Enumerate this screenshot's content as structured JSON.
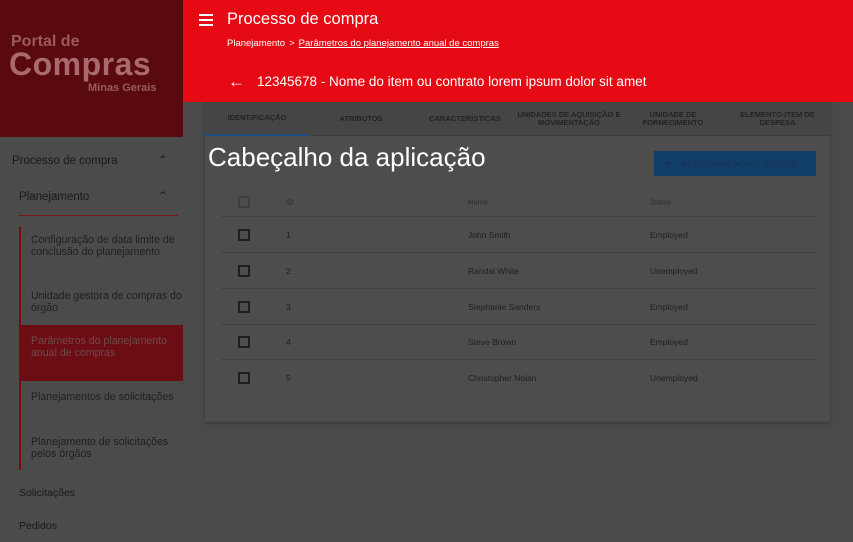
{
  "brand": {
    "line1": "Portal de",
    "line2": "Compras",
    "line3": "Minas Gerais"
  },
  "sidebar": {
    "processo": "Processo de compra",
    "planejamento": "Planejamento",
    "items": [
      {
        "label": "Configuração de data limite de conclusão do planejamento"
      },
      {
        "label": "Unidade gestora de compras do órgão"
      },
      {
        "label": "Parâmetros do planejamento anual de compras"
      },
      {
        "label": "Planejamentos de solicitações"
      },
      {
        "label": "Planejamento de solicitações pelos órgãos"
      }
    ],
    "solicitacoes": "Solicitações",
    "pedidos": "Pedidos"
  },
  "header": {
    "title": "Processo de compra",
    "breadcrumb_root": "Planejamento",
    "breadcrumb_sep": ">",
    "breadcrumb_current": "Parâmetros do planejamento anual de compras",
    "item_title": "12345678 - Nome do item ou contrato lorem ipsum dolor sit amet",
    "back_icon": "arrow-left-icon",
    "menu_icon": "hamburger-menu-icon"
  },
  "tabs": [
    {
      "label": "IDENTIFICAÇÃO",
      "active": true
    },
    {
      "label": "ATRIBUTOS"
    },
    {
      "label": "CARACTERÍSTICAS"
    },
    {
      "label": "UNIDADES DE AQUISIÇÃO E MOVIMENTAÇÃO"
    },
    {
      "label": "UNIDADE DE FORNECIMENTO"
    },
    {
      "label": "ELEMENTO-ITEM DE DESPESA"
    }
  ],
  "overlay_label": "Cabeçalho da aplicação",
  "add_button": {
    "label": "ADICIONAR NOVO OBJETO",
    "icon": "plus-icon"
  },
  "table": {
    "headers": {
      "id": "ID",
      "name": "Name",
      "status": "Status"
    },
    "rows": [
      {
        "id": "1",
        "name": "John Smith",
        "status": "Employed"
      },
      {
        "id": "2",
        "name": "Randal White",
        "status": "Unemployed"
      },
      {
        "id": "3",
        "name": "Stephanie Sanders",
        "status": "Employed"
      },
      {
        "id": "4",
        "name": "Steve Brown",
        "status": "Employed"
      },
      {
        "id": "5",
        "name": "Christopher Nolan",
        "status": "Unemployed"
      }
    ]
  },
  "colors": {
    "header_red": "#e50a14",
    "brand_dark": "#5a0a0e",
    "primary_blue": "#123f6a"
  }
}
